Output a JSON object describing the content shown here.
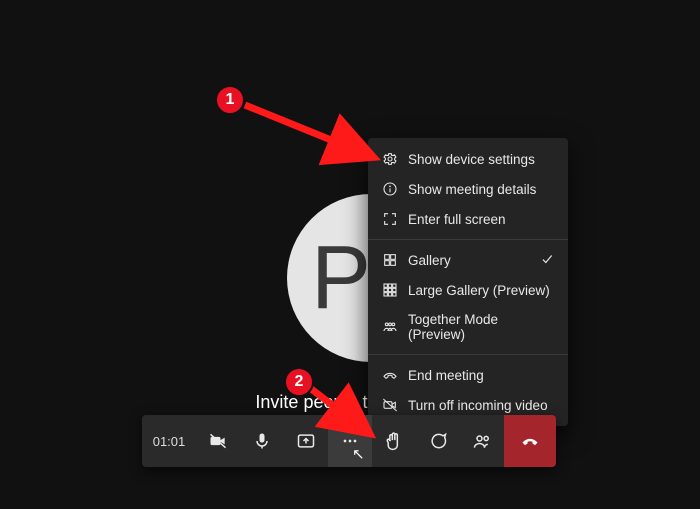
{
  "avatar": {
    "initial": "P"
  },
  "invite": {
    "text": "Invite people to join you"
  },
  "toolbar": {
    "timer": "01:01"
  },
  "menu": {
    "items": [
      {
        "icon": "gear",
        "label": "Show device settings"
      },
      {
        "icon": "info",
        "label": "Show meeting details"
      },
      {
        "icon": "fullscreen",
        "label": "Enter full screen"
      }
    ],
    "view_items": [
      {
        "icon": "grid2",
        "label": "Gallery",
        "checked": true
      },
      {
        "icon": "grid3",
        "label": "Large Gallery (Preview)",
        "checked": false
      },
      {
        "icon": "people",
        "label": "Together Mode (Preview)",
        "checked": false
      }
    ],
    "end_items": [
      {
        "icon": "phone-end",
        "label": "End meeting"
      },
      {
        "icon": "video-off",
        "label": "Turn off incoming video"
      }
    ]
  },
  "annotations": {
    "c1": "1",
    "c2": "2"
  }
}
